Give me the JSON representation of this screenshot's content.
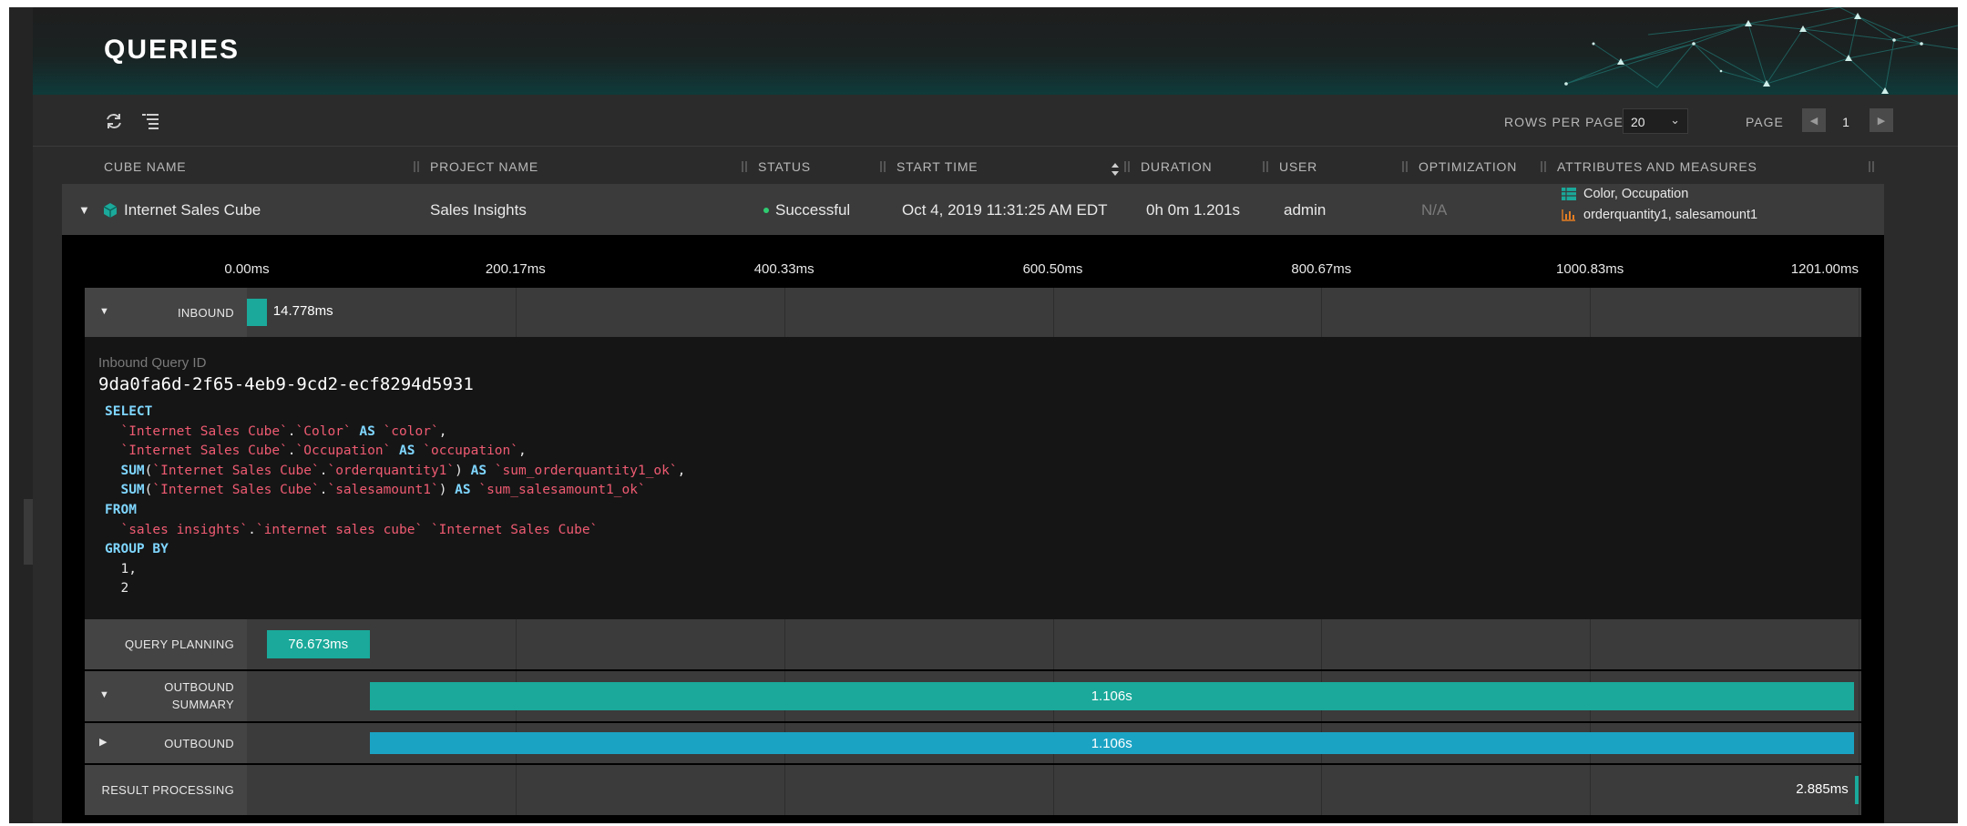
{
  "header": {
    "title": "QUERIES"
  },
  "toolbar": {
    "refresh_icon": "refresh-icon",
    "filter_icon": "filter-list-icon",
    "rows_per_page_label": "ROWS PER PAGE",
    "rows_per_page_value": "20",
    "page_label": "PAGE",
    "page_number": "1"
  },
  "columns": {
    "cube_name": "CUBE NAME",
    "project_name": "PROJECT NAME",
    "status": "STATUS",
    "start_time": "START TIME",
    "duration": "DURATION",
    "user": "USER",
    "optimization": "OPTIMIZATION",
    "attributes_measures": "ATTRIBUTES AND MEASURES"
  },
  "row": {
    "cube_name": "Internet Sales Cube",
    "project_name": "Sales Insights",
    "status": "Successful",
    "start_time": "Oct 4, 2019 11:31:25 AM EDT",
    "duration": "0h 0m 1.201s",
    "user": "admin",
    "optimization": "N/A",
    "attributes": "Color, Occupation",
    "measures": "orderquantity1, salesamount1",
    "status_color": "#2ecc71"
  },
  "timeline": {
    "ticks": [
      "0.00ms",
      "200.17ms",
      "400.33ms",
      "600.50ms",
      "800.67ms",
      "1000.83ms",
      "1201.00ms"
    ],
    "total_ms": 1201.0,
    "stages": {
      "inbound": {
        "label": "INBOUND",
        "start_ms": 0,
        "duration_ms": 14.778,
        "value_label": "14.778ms"
      },
      "query_planning": {
        "label": "QUERY PLANNING",
        "start_ms": 14.778,
        "duration_ms": 76.673,
        "value_label": "76.673ms"
      },
      "outbound_summary": {
        "label_line1": "OUTBOUND",
        "label_line2": "SUMMARY",
        "start_ms": 91.451,
        "duration_ms": 1106,
        "value_label": "1.106s"
      },
      "outbound": {
        "label": "OUTBOUND",
        "start_ms": 91.451,
        "duration_ms": 1106,
        "value_label": "1.106s"
      },
      "result_processing": {
        "label": "RESULT PROCESSING",
        "start_ms": 1198.115,
        "duration_ms": 2.885,
        "value_label": "2.885ms"
      }
    }
  },
  "inbound_detail": {
    "id_label": "Inbound Query ID",
    "id": "9da0fa6d-2f65-4eb9-9cd2-ecf8294d5931",
    "sql": {
      "select": "SELECT",
      "l1_a": "`Internet Sales Cube`",
      "l1_b": "`Color`",
      "l1_as": "AS",
      "l1_c": "`color`",
      "l2_a": "`Internet Sales Cube`",
      "l2_b": "`Occupation`",
      "l2_as": "AS",
      "l2_c": "`occupation`",
      "l3_fn": "SUM",
      "l3_a": "`Internet Sales Cube`",
      "l3_b": "`orderquantity1`",
      "l3_as": "AS",
      "l3_c": "`sum_orderquantity1_ok`",
      "l4_fn": "SUM",
      "l4_a": "`Internet Sales Cube`",
      "l4_b": "`salesamount1`",
      "l4_as": "AS",
      "l4_c": "`sum_salesamount1_ok`",
      "from": "FROM",
      "f_a": "`sales insights`",
      "f_b": "`internet sales cube`",
      "f_c": "`Internet Sales Cube`",
      "group_by": "GROUP BY",
      "g1": "1,",
      "g2": "2"
    }
  },
  "colors": {
    "accent_teal": "#1aa99a",
    "outbound_blue": "#1ba3c4",
    "keyword": "#7fd6ff",
    "identifier": "#ef5b72"
  }
}
